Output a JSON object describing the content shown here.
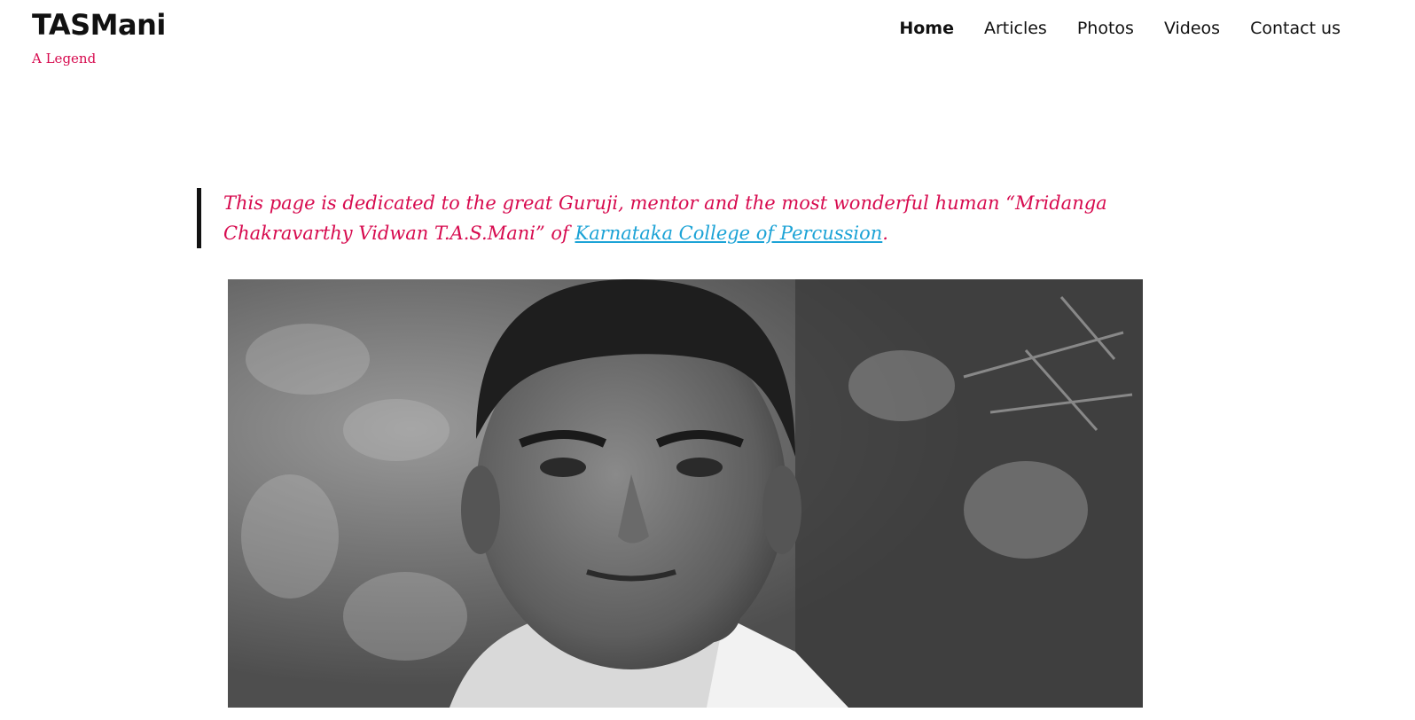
{
  "site": {
    "title": "TASMani",
    "tagline": "A Legend"
  },
  "nav": {
    "items": [
      {
        "label": "Home",
        "current": true
      },
      {
        "label": "Articles",
        "current": false
      },
      {
        "label": "Photos",
        "current": false
      },
      {
        "label": "Videos",
        "current": false
      },
      {
        "label": "Contact us",
        "current": false
      }
    ]
  },
  "dedication": {
    "text_before_link": "This page is dedicated to the great Guruji, mentor and the most wonderful human “Mridanga Chakravarthy Vidwan T.A.S.Mani” of ",
    "link_text": "Karnataka College of Percussion",
    "text_after_link": "."
  },
  "colors": {
    "accent": "#d70b4f",
    "link": "#1ca3d6",
    "text": "#111111",
    "background": "#ffffff"
  }
}
